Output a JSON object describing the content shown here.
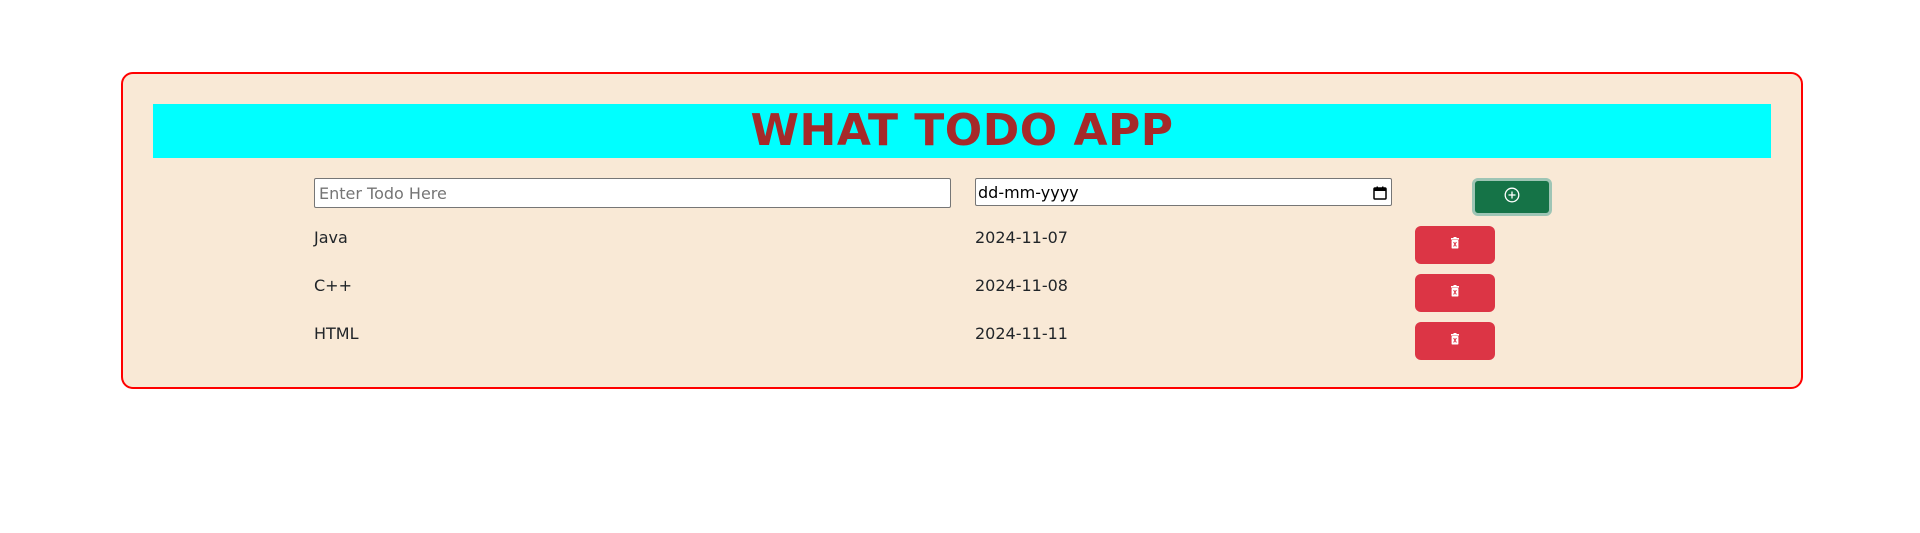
{
  "app": {
    "title": "WHAT TODO APP"
  },
  "form": {
    "todo_placeholder": "Enter Todo Here",
    "date_value": "dd-mm-yyyy",
    "add_icon": "plus-circle-icon"
  },
  "todos": [
    {
      "name": "Java",
      "date": "2024-11-07",
      "delete_icon": "trash-icon"
    },
    {
      "name": "C++",
      "date": "2024-11-08",
      "delete_icon": "trash-icon"
    },
    {
      "name": "HTML",
      "date": "2024-11-11",
      "delete_icon": "trash-icon"
    }
  ],
  "colors": {
    "card_border": "#ff0000",
    "card_background": "#f9e9d6",
    "title_background": "#00ffff",
    "title_text": "#a52a2a",
    "add_button": "#157347",
    "delete_button": "#dc3545"
  }
}
